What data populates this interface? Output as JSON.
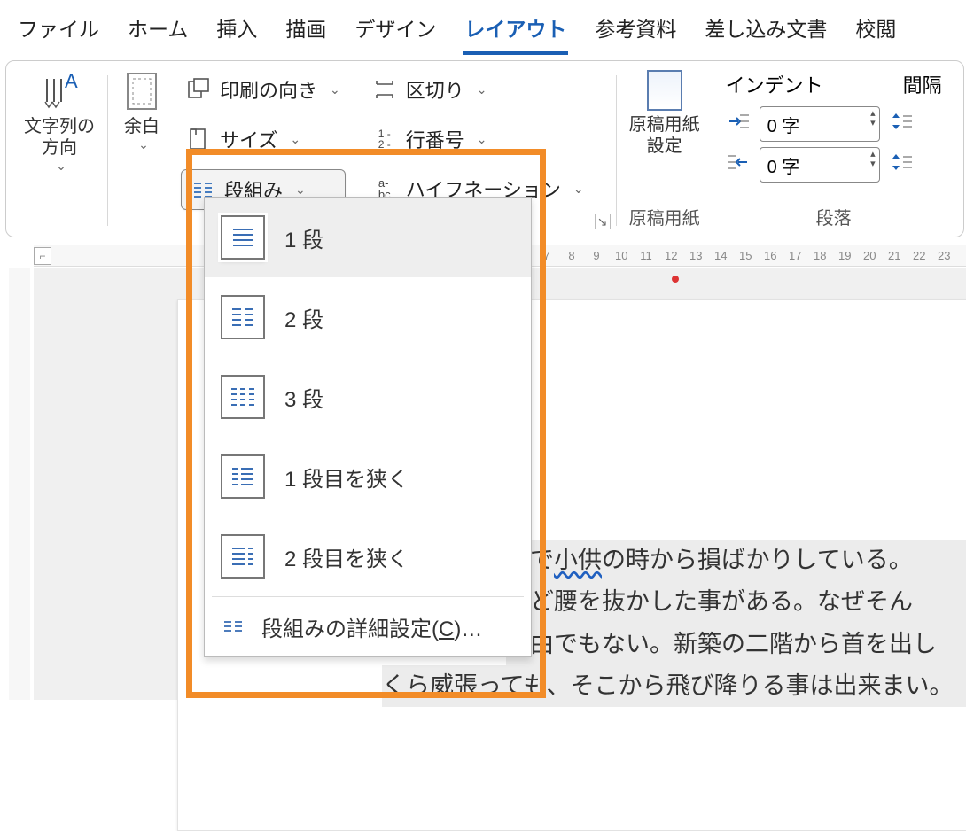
{
  "tabs": [
    "ファイル",
    "ホーム",
    "挿入",
    "描画",
    "デザイン",
    "レイアウト",
    "参考資料",
    "差し込み文書",
    "校閲"
  ],
  "active_tab_index": 5,
  "ribbon": {
    "text_direction": {
      "label": "文字列の\n方向"
    },
    "margins": {
      "label": "余白"
    },
    "page_setup_col": {
      "orientation": "印刷の向き",
      "size": "サイズ",
      "columns": "段組み"
    },
    "breaks_col": {
      "breaks": "区切り",
      "line_numbers": "行番号",
      "hyphenation": "ハイフネーション"
    },
    "manuscript": {
      "btn": "原稿用紙\n設定",
      "group_label": "原稿用紙"
    },
    "indent": {
      "title": "インデント",
      "left_value": "0 字",
      "right_value": "0 字"
    },
    "spacing": {
      "title": "間隔"
    },
    "paragraph_group_label": "段落"
  },
  "columns_dropdown": {
    "items": [
      {
        "label": "1 段"
      },
      {
        "label": "2 段"
      },
      {
        "label": "3 段"
      },
      {
        "label": "1 段目を狭く"
      },
      {
        "label": "2 段目を狭く"
      }
    ],
    "more_prefix": "段組みの詳細設定(",
    "more_key": "C",
    "more_suffix": ")…"
  },
  "ruler_numbers": [
    "7",
    "8",
    "9",
    "10",
    "11",
    "12",
    "13",
    "14",
    "15",
    "16",
    "17",
    "18",
    "19",
    "20",
    "21",
    "22",
    "23"
  ],
  "document": {
    "line1_a": "砲で",
    "line1_wavy": "小供",
    "line1_b": "の時から損ばかりしている。",
    "line2": "ほど腰を抜かした事がある。なぜそん",
    "line3": "理由でもない。新築の二階から首を出し",
    "line4": "くら威張っても、そこから飛び降りる事は出来まい。"
  }
}
